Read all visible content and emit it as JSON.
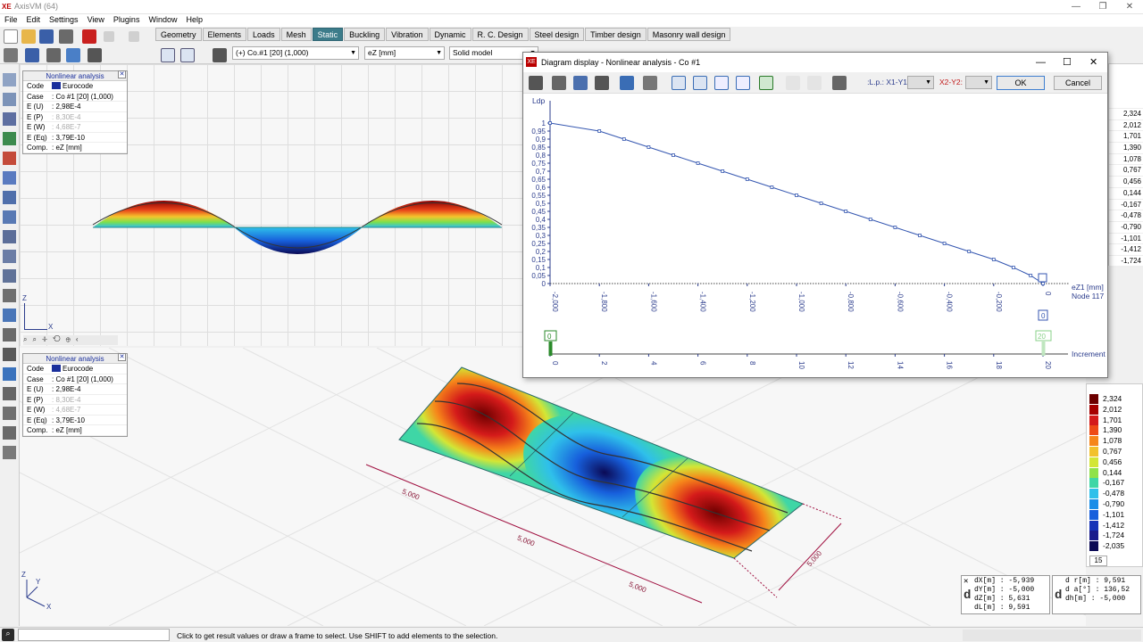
{
  "app": {
    "title": "AxisVM (64)",
    "logo": "XE"
  },
  "menu": [
    "File",
    "Edit",
    "Settings",
    "View",
    "Plugins",
    "Window",
    "Help"
  ],
  "tabs": [
    {
      "label": "Geometry"
    },
    {
      "label": "Elements"
    },
    {
      "label": "Loads"
    },
    {
      "label": "Mesh"
    },
    {
      "label": "Static",
      "active": true
    },
    {
      "label": "Buckling"
    },
    {
      "label": "Vibration"
    },
    {
      "label": "Dynamic"
    },
    {
      "label": "R. C. Design"
    },
    {
      "label": "Steel design"
    },
    {
      "label": "Timber design"
    },
    {
      "label": "Masonry wall design"
    }
  ],
  "toolbar": {
    "case_select": "(+) Co.#1 [20] (1,000)",
    "component_select": "eZ [mm]",
    "display_select": "Solid model"
  },
  "infobox": {
    "title": "Nonlinear analysis",
    "rows": [
      {
        "k": "Code",
        "v": "Eurocode"
      },
      {
        "k": "Case",
        "v": ": Co #1 [20] (1,000)"
      },
      {
        "k": "E (U)",
        "v": ": 2,98E-4"
      },
      {
        "k": "E (P)",
        "v": ": 8,30E-4"
      },
      {
        "k": "E (W)",
        "v": ": 4,68E-7"
      },
      {
        "k": "E (Eq)",
        "v": ": 3,79E-10"
      },
      {
        "k": "Comp.",
        "v": ": eZ [mm]"
      }
    ]
  },
  "dialog": {
    "title": "Diagram display - Nonlinear analysis - Co #1",
    "lp_label": "L.p.: X1-Y1:",
    "x2y2_label": "X2-Y2:",
    "ok": "OK",
    "cancel": "Cancel",
    "node_label": "Node 117",
    "increment_label": "Increment",
    "slider_start": "0",
    "slider_end": "20",
    "marker_value": "0"
  },
  "chart_data": {
    "type": "line",
    "title": "",
    "ylabel": "Ldp",
    "xlabel": "eZ1 [mm]",
    "x": [
      -2.0,
      -1.8,
      -1.6,
      -1.4,
      -1.2,
      -1.0,
      -0.8,
      -0.6,
      -0.4,
      -0.2,
      0.0
    ],
    "x_ticks": [
      "-2,000",
      "-1,800",
      "-1,600",
      "-1,400",
      "-1,200",
      "-1,000",
      "-0,800",
      "-0,600",
      "-0,400",
      "-0,200",
      "0"
    ],
    "y_ticks": [
      "1",
      "0,95",
      "0,9",
      "0,85",
      "0,8",
      "0,75",
      "0,7",
      "0,65",
      "0,6",
      "0,55",
      "0,5",
      "0,45",
      "0,4",
      "0,35",
      "0,3",
      "0,25",
      "0,2",
      "0,15",
      "0,1",
      "0,05",
      "0"
    ],
    "series": [
      {
        "points": [
          [
            -2.0,
            1.0
          ],
          [
            -1.8,
            0.95
          ],
          [
            -1.7,
            0.9
          ],
          [
            -1.6,
            0.85
          ],
          [
            -1.5,
            0.8
          ],
          [
            -1.4,
            0.75
          ],
          [
            -1.3,
            0.7
          ],
          [
            -1.2,
            0.65
          ],
          [
            -1.1,
            0.6
          ],
          [
            -1.0,
            0.55
          ],
          [
            -0.9,
            0.5
          ],
          [
            -0.8,
            0.45
          ],
          [
            -0.7,
            0.4
          ],
          [
            -0.6,
            0.35
          ],
          [
            -0.5,
            0.3
          ],
          [
            -0.4,
            0.25
          ],
          [
            -0.3,
            0.2
          ],
          [
            -0.2,
            0.15
          ],
          [
            -0.12,
            0.1
          ],
          [
            -0.05,
            0.05
          ],
          [
            0.0,
            0.0
          ]
        ]
      }
    ],
    "increment_ticks": [
      "0",
      "2",
      "4",
      "6",
      "8",
      "10",
      "12",
      "14",
      "16",
      "18",
      "20"
    ],
    "ylim": [
      0,
      1
    ],
    "xlim": [
      -2.0,
      0.0
    ]
  },
  "legend_scale": {
    "values": [
      "2,324",
      "2,012",
      "1,701",
      "1,390",
      "1,078",
      "0,767",
      "0,456",
      "0,144",
      "-0,167",
      "-0,478",
      "-0,790",
      "-1,101",
      "-1,412",
      "-1,724",
      "-2,035"
    ],
    "colors": [
      "#6d0000",
      "#a60000",
      "#d41a1a",
      "#ee4a15",
      "#f6861a",
      "#f2c12c",
      "#d3e635",
      "#8fe24a",
      "#3fd6a6",
      "#2fc0ea",
      "#1a8ee8",
      "#175fdc",
      "#1733b8",
      "#1a1c8c",
      "#0b0a55"
    ],
    "count": "15"
  },
  "right_partial": [
    "2,324",
    "2,012",
    "1,701",
    "1,390",
    "1,078",
    "0,767",
    "0,456",
    "0,144",
    "-0,167",
    "-0,478",
    "-0,790",
    "-1,101",
    "-1,412",
    "-1,724",
    "-2,035"
  ],
  "dims": [
    "5,000",
    "5,000",
    "5,000",
    "5,000"
  ],
  "coords": {
    "left": [
      [
        "dX[m]",
        ": -5,939"
      ],
      [
        "dY[m]",
        ": -5,000"
      ],
      [
        "dZ[m]",
        ": 5,631"
      ],
      [
        "dL[m]",
        ": 9,591"
      ]
    ],
    "right": [
      [
        "d r[m]",
        ": 9,591"
      ],
      [
        "d a[°]",
        ": 136,52"
      ],
      [
        "dh[m]",
        ": -5,000"
      ]
    ]
  },
  "status": {
    "text": "Click to get result values or draw a frame to select. Use SHIFT to add elements to the selection."
  }
}
